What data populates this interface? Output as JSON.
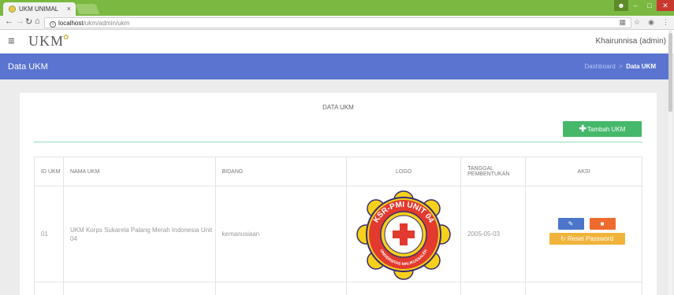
{
  "browser": {
    "tab_title": "UKM UNIMAL",
    "tab_close": "×",
    "url_host": "localhost",
    "url_path": "/ukm/admin/ukm",
    "info_glyph": "i"
  },
  "header": {
    "brand": "UKM",
    "user": "Khairunnisa (admin)"
  },
  "page": {
    "title": "Data UKM",
    "breadcrumb_home": "Dashboard",
    "breadcrumb_sep": ">",
    "breadcrumb_current": "Data UKM"
  },
  "card": {
    "title": "DATA UKM",
    "add_button_label": "Tambah UKM"
  },
  "table": {
    "columns": {
      "id": "ID UKM",
      "name": "NAMA UKM",
      "field": "BIDANG",
      "logo": "LOGO",
      "date": "TANGGAL PEMBENTUKAN",
      "actions": "AKSI"
    },
    "rows": [
      {
        "id": "01",
        "name": "UKM Korps Sukarela Palang Merah Indonesia Unit 04",
        "field": "kemanusiaan",
        "date": "2005-05-03",
        "logo_text_top": "KSR-PMI UNIT 04",
        "logo_text_bottom": "UNIVERSITAS MALIKUSSALEH",
        "reset_label": "Reset Password"
      }
    ]
  },
  "colors": {
    "tabbar": "#7ab842",
    "page_header": "#5a74d0",
    "add_button": "#45b86a",
    "edit_button": "#4c76c9",
    "delete_button": "#ee6b2d",
    "reset_button": "#f0b33b"
  }
}
